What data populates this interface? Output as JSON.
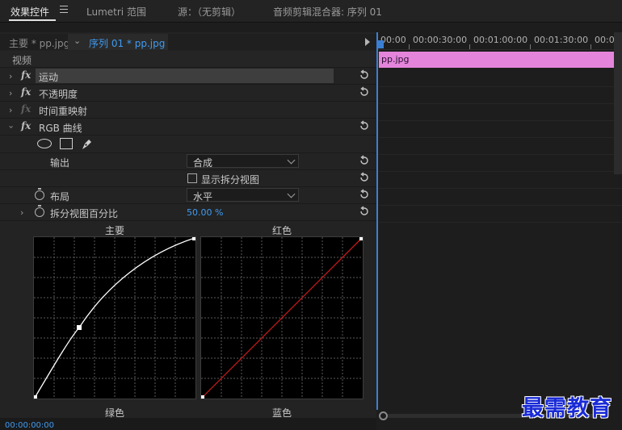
{
  "tabs": [
    {
      "label": "效果控件",
      "active": true
    },
    {
      "label": "Lumetri 范围",
      "active": false
    },
    {
      "label": "源：（无剪辑）",
      "active": false
    },
    {
      "label": "音频剪辑混合器: 序列 01",
      "active": false
    }
  ],
  "source": {
    "main": "主要 * pp.jpg",
    "sequence": "序列 01 * pp.jpg"
  },
  "video_header": "视频",
  "effects": {
    "motion": "运动",
    "opacity": "不透明度",
    "time_remap": "时间重映射",
    "rgb_curves": "RGB 曲线"
  },
  "rgb": {
    "output_label": "输出",
    "output_value": "合成",
    "split_view_label": "显示拆分视图",
    "split_view_checked": false,
    "layout_label": "布局",
    "layout_value": "水平",
    "split_percent_label": "拆分视图百分比",
    "split_percent_value": "50.00 %"
  },
  "curves": {
    "master": "主要",
    "red": "红色",
    "green": "绿色",
    "blue": "蓝色",
    "master_point": {
      "input": 0.28,
      "output": 0.44
    },
    "colors": {
      "master": "#ffffff",
      "red": "#c41818"
    }
  },
  "timeline": {
    "ruler": [
      "00:00",
      "00:00:30:00",
      "00:01:00:00",
      "00:01:30:00",
      "00:0"
    ],
    "clip": "pp.jpg",
    "clip_color": "#e485db"
  },
  "timecode": "00:00:00:00",
  "watermark": "最需教育"
}
